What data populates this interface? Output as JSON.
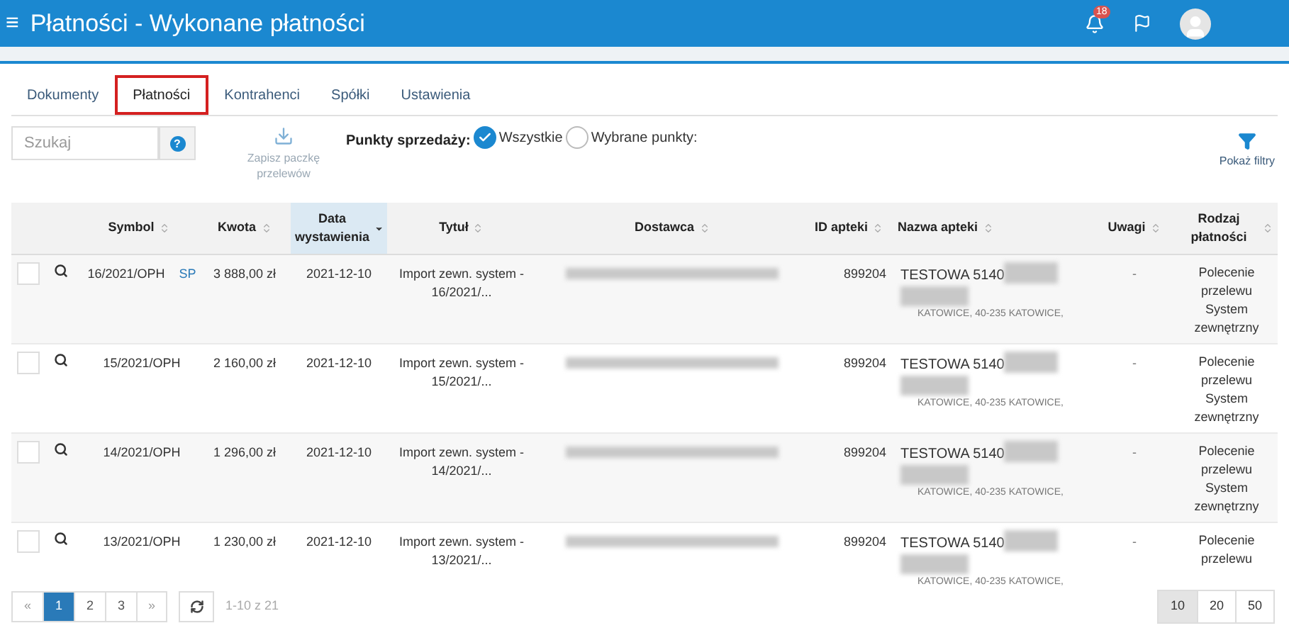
{
  "header": {
    "menu_glyph": "≡",
    "title": "Płatności - Wykonane płatności",
    "notifications_count": "18"
  },
  "tabs": [
    {
      "label": "Dokumenty",
      "selected": false
    },
    {
      "label": "Płatności",
      "selected": true
    },
    {
      "label": "Kontrahenci",
      "selected": false
    },
    {
      "label": "Spółki",
      "selected": false
    },
    {
      "label": "Ustawienia",
      "selected": false
    }
  ],
  "toolbar": {
    "search": {
      "placeholder": "Szukaj"
    },
    "help_glyph": "?",
    "save_button": {
      "label": "Zapisz paczkę przelewów",
      "disabled": true
    },
    "points_label": "Punkty sprzedaży:",
    "points_options": [
      {
        "label": "Wszystkie",
        "selected": true
      },
      {
        "label": "Wybrane punkty:",
        "selected": false
      }
    ],
    "filters_button": "Pokaż filtry"
  },
  "table": {
    "columns": [
      {
        "label": "Symbol",
        "sorted": false
      },
      {
        "label": "Kwota",
        "sorted": false
      },
      {
        "label": "Data wystawienia",
        "sorted": true
      },
      {
        "label": "Tytuł",
        "sorted": false
      },
      {
        "label": "Dostawca",
        "sorted": false
      },
      {
        "label": "ID apteki",
        "sorted": false
      },
      {
        "label": "Nazwa apteki",
        "sorted": false
      },
      {
        "label": "Uwagi",
        "sorted": false
      },
      {
        "label": "Rodzaj płatności",
        "sorted": false
      }
    ],
    "rows": [
      {
        "checked": false,
        "symbol": "16/2021/OPH",
        "tag": "SP",
        "amount": "3 888,00 zł",
        "date": "2021-12-10",
        "title": "Import zewn. system - 16/2021/...",
        "pharmacy_id": "899204",
        "pharmacy_name": "TESTOWA 5140",
        "pharmacy_address": "KATOWICE, 40-235 KATOWICE,",
        "notes": "-",
        "payment_type": [
          "Polecenie",
          "przelewu",
          "System",
          "zewnętrzny"
        ]
      },
      {
        "checked": false,
        "symbol": "15/2021/OPH",
        "amount": "2 160,00 zł",
        "date": "2021-12-10",
        "title": "Import zewn. system - 15/2021/...",
        "pharmacy_id": "899204",
        "pharmacy_name": "TESTOWA 5140",
        "pharmacy_address": "KATOWICE, 40-235 KATOWICE,",
        "notes": "-",
        "payment_type": [
          "Polecenie",
          "przelewu",
          "System",
          "zewnętrzny"
        ]
      },
      {
        "checked": false,
        "symbol": "14/2021/OPH",
        "amount": "1 296,00 zł",
        "date": "2021-12-10",
        "title": "Import zewn. system - 14/2021/...",
        "pharmacy_id": "899204",
        "pharmacy_name": "TESTOWA 5140",
        "pharmacy_address": "KATOWICE, 40-235 KATOWICE,",
        "notes": "-",
        "payment_type": [
          "Polecenie",
          "przelewu",
          "System",
          "zewnętrzny"
        ]
      },
      {
        "checked": false,
        "symbol": "13/2021/OPH",
        "amount": "1 230,00 zł",
        "date": "2021-12-10",
        "title": "Import zewn. system - 13/2021/...",
        "pharmacy_id": "899204",
        "pharmacy_name": "TESTOWA 5140",
        "pharmacy_address": "KATOWICE, 40-235 KATOWICE,",
        "notes": "-",
        "payment_type": [
          "Polecenie",
          "przelewu"
        ]
      }
    ]
  },
  "pagination": {
    "prev": "«",
    "pages": [
      {
        "label": "1",
        "selected": true
      },
      {
        "label": "2",
        "selected": false
      },
      {
        "label": "3",
        "selected": false
      }
    ],
    "next": "»",
    "range": "1-10 z 21",
    "page_sizes": [
      {
        "label": "10",
        "selected": true
      },
      {
        "label": "20",
        "selected": false
      },
      {
        "label": "50",
        "selected": false
      }
    ]
  }
}
